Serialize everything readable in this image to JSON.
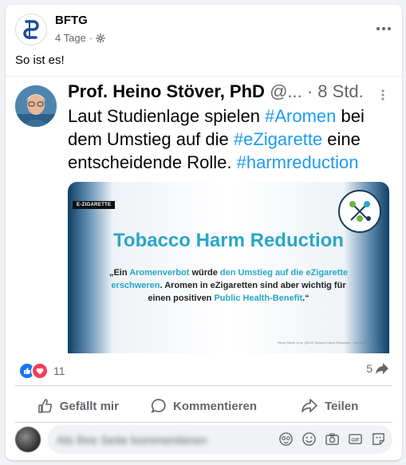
{
  "post": {
    "author": "BFTG",
    "time": "4 Tage",
    "text": "So ist es!"
  },
  "tweet": {
    "name": "Prof. Heino Stöver, PhD",
    "handle": "@...",
    "time": "· 8 Std.",
    "body": [
      {
        "t": "Laut Studienlage spielen ",
        "tag": false
      },
      {
        "t": "#Aromen",
        "tag": true
      },
      {
        "t": " bei dem Umstieg auf die ",
        "tag": false
      },
      {
        "t": "#eZigarette",
        "tag": true
      },
      {
        "t": " eine entscheidende Rolle. ",
        "tag": false
      },
      {
        "t": "#harmreduction",
        "tag": true
      }
    ],
    "slide": {
      "badge": "E-ZIGARETTE",
      "title": "Tobacco Harm Reduction",
      "quote": [
        {
          "t": "„Ein ",
          "hl": false
        },
        {
          "t": "Aromenverbot",
          "hl": true
        },
        {
          "t": " würde ",
          "hl": false
        },
        {
          "t": "den Umstieg auf die eZigarette erschweren",
          "hl": true
        },
        {
          "t": ". Aromen in eZigaretten sind aber wichtig für einen positiven ",
          "hl": false
        },
        {
          "t": "Public Health-Benefit",
          "hl": true
        },
        {
          "t": ".“",
          "hl": false
        }
      ],
      "footnote": "Heino Stöver et al. (2022) Tobacco Harm Reduction · Fachverband"
    }
  },
  "stats": {
    "reactions": "11",
    "shares": "5"
  },
  "actions": {
    "like": "Gefällt mir",
    "comment": "Kommentieren",
    "share": "Teilen"
  },
  "comment": {
    "placeholder": "Als Ihre Seite kommentieren"
  },
  "colors": {
    "link": "#1d9bf0",
    "like_blue": "#1877f2",
    "love_red": "#f33e58",
    "slide_accent": "#2aa6c7"
  }
}
